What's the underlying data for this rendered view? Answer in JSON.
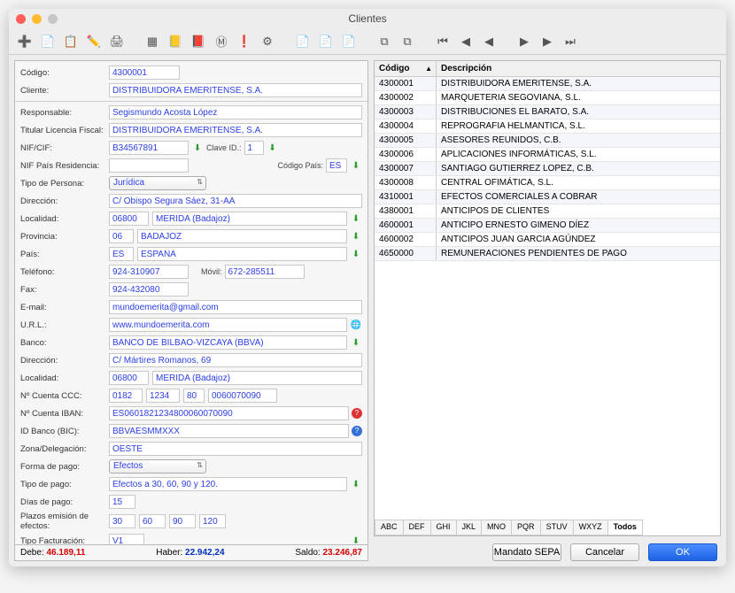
{
  "window": {
    "title": "Clientes"
  },
  "toolbar_icons": [
    "➕",
    "📄",
    "📋",
    "✏️",
    "🖨",
    "│",
    "▦",
    "📒",
    "📕",
    "Ⓜ",
    "❗",
    "⚙",
    "│",
    "📄",
    "📄",
    "📄",
    "│",
    "⧉",
    "⧉",
    "│",
    "⏮",
    "◀",
    "◀",
    "│",
    "▶",
    "▶",
    "⏭"
  ],
  "form": {
    "codigo_lbl": "Código:",
    "codigo": "4300001",
    "cliente_lbl": "Cliente:",
    "cliente": "DISTRIBUIDORA EMERITENSE, S.A.",
    "responsable_lbl": "Responsable:",
    "responsable": "Segismundo Acosta López",
    "titularlic_lbl": "Titular Licencia Fiscal:",
    "titularlic": "DISTRIBUIDORA EMERITENSE, S.A.",
    "nifcif_lbl": "NIF/CIF:",
    "nifcif": "B34567891",
    "claveid_lbl": "Clave ID.:",
    "claveid": "1",
    "nifpais_lbl": "NIF País Residencia:",
    "nifpais": "",
    "codpais_lbl": "Código País:",
    "codpais": "ES",
    "tipopersona_lbl": "Tipo de Persona:",
    "tipopersona": "Jurídica",
    "direccion_lbl": "Dirección:",
    "direccion": "C/ Obispo Segura Sáez, 31-AA",
    "localidad_lbl": "Localidad:",
    "cp": "06800",
    "localidad": "MERIDA (Badajoz)",
    "provincia_lbl": "Provincia:",
    "provcod": "06",
    "provincia": "BADAJOZ",
    "pais_lbl": "País:",
    "paiscod": "ES",
    "pais": "ESPAÑA",
    "telefono_lbl": "Teléfono:",
    "telefono": "924-310907",
    "movil_lbl": "Móvil:",
    "movil": "672-285511",
    "fax_lbl": "Fax:",
    "fax": "924-432080",
    "email_lbl": "E-mail:",
    "email": "mundoemerita@gmail.com",
    "url_lbl": "U.R.L.:",
    "url": "www.mundoemerita.com",
    "banco_lbl": "Banco:",
    "banco": "BANCO DE BILBAO-VIZCAYA (BBVA)",
    "direccion2_lbl": "Dirección:",
    "direccion2": "C/ Mártires Romanos, 69",
    "localidad2_lbl": "Localidad:",
    "cp2": "06800",
    "localidad2": "MERIDA (Badajoz)",
    "ccc_lbl": "Nº Cuenta CCC:",
    "ccc1": "0182",
    "ccc2": "1234",
    "ccc3": "80",
    "ccc4": "0060070090",
    "iban_lbl": "Nº Cuenta IBAN:",
    "iban": "ES0601821234800060070090",
    "bic_lbl": "ID Banco (BIC):",
    "bic": "BBVAESMMXXX",
    "zona_lbl": "Zona/Delegación:",
    "zona": "OESTE",
    "formapago_lbl": "Forma de pago:",
    "formapago": "Efectos",
    "tipopago_lbl": "Tipo de pago:",
    "tipopago": "Efectos a 30, 60, 90 y 120.",
    "diaspago_lbl": "Días de pago:",
    "diaspago": "15",
    "plazos_lbl": "Plazos emisión de efectos:",
    "p1": "30",
    "p2": "60",
    "p3": "90",
    "p4": "120",
    "tipofact_lbl": "Tipo Facturación:",
    "tipofact": "V1"
  },
  "totals": {
    "debe_lbl": "Debe:",
    "debe": "46.189,11",
    "haber_lbl": "Haber:",
    "haber": "22.942,24",
    "saldo_lbl": "Saldo:",
    "saldo": "23.246,87"
  },
  "grid": {
    "col_codigo": "Código",
    "col_desc": "Descripción",
    "rows": [
      {
        "c": "4300001",
        "d": "DISTRIBUIDORA EMERITENSE, S.A."
      },
      {
        "c": "4300002",
        "d": "MARQUETERIA SEGOVIANA, S.L."
      },
      {
        "c": "4300003",
        "d": "DISTRIBUCIONES EL BARATO, S.A."
      },
      {
        "c": "4300004",
        "d": "REPROGRAFIA HELMANTICA, S.L."
      },
      {
        "c": "4300005",
        "d": "ASESORES REUNIDOS, C.B."
      },
      {
        "c": "4300006",
        "d": "APLICACIONES INFORMÁTICAS, S.L."
      },
      {
        "c": "4300007",
        "d": "SANTIAGO GUTIERREZ LOPEZ, C.B."
      },
      {
        "c": "4300008",
        "d": "CENTRAL OFIMÁTICA, S.L."
      },
      {
        "c": "4310001",
        "d": "EFECTOS COMERCIALES A COBRAR"
      },
      {
        "c": "4380001",
        "d": "ANTICIPOS DE CLIENTES"
      },
      {
        "c": "4600001",
        "d": "ANTICIPO ERNESTO GIMENO DÍEZ"
      },
      {
        "c": "4600002",
        "d": "ANTICIPOS JUAN GARCIA AGÚNDEZ"
      },
      {
        "c": "4650000",
        "d": "REMUNERACIONES PENDIENTES DE PAGO"
      }
    ]
  },
  "tabs": [
    "ABC",
    "DEF",
    "GHI",
    "JKL",
    "MNO",
    "PQR",
    "STUV",
    "WXYZ",
    "Todos"
  ],
  "active_tab": 8,
  "buttons": {
    "sepa": "Mandato SEPA",
    "cancel": "Cancelar",
    "ok": "OK"
  }
}
